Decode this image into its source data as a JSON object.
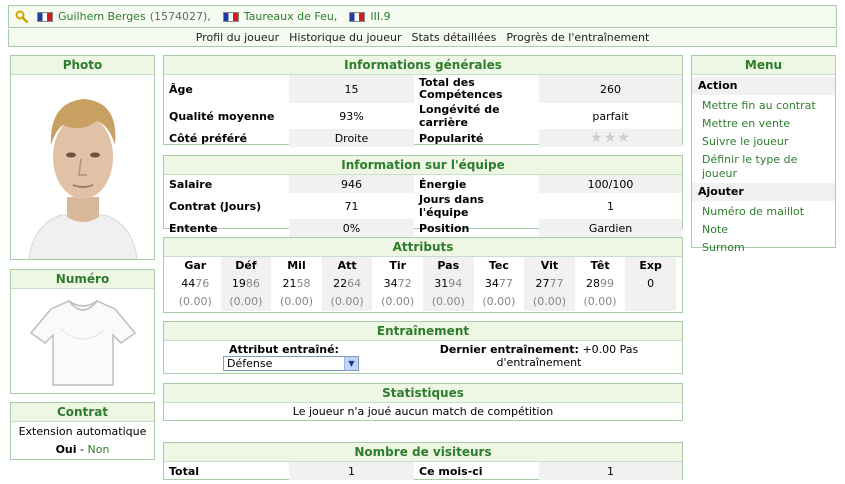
{
  "header": {
    "player_name": "Guilhem Berges",
    "player_id": "(1574027),",
    "team_name": "Taureaux de Feu,",
    "league": "III.9"
  },
  "tabs": [
    "Profil du joueur",
    "Historique du joueur",
    "Stats détaillées",
    "Progrès de l'entraînement"
  ],
  "photo": {
    "title": "Photo"
  },
  "numero": {
    "title": "Numéro"
  },
  "contrat": {
    "title": "Contrat",
    "extension": "Extension automatique",
    "yes": "Oui",
    "dash": " - ",
    "no": "Non"
  },
  "general": {
    "title": "Informations générales",
    "age_label": "Âge",
    "age": "15",
    "total_label": "Total des Compétences",
    "total": "260",
    "quality_label": "Qualité moyenne",
    "quality": "93%",
    "longevity_label": "Longévité de carrière",
    "longevity": "parfait",
    "side_label": "Côté préféré",
    "side": "Droite",
    "popularity_label": "Popularité",
    "popularity_stars": 0
  },
  "team": {
    "title": "Information sur l'équipe",
    "salary_label": "Salaire",
    "salary": "946",
    "energy_label": "Énergie",
    "energy": "100/100",
    "contract_label": "Contrat (Jours)",
    "contract": "71",
    "days_label": "Jours dans l'équipe",
    "days": "1",
    "entente_label": "Entente",
    "entente": "0%",
    "position_label": "Position",
    "position": "Gardien"
  },
  "attributes": {
    "title": "Attributs",
    "items": [
      {
        "name": "Gar",
        "whole": "44",
        "dec": "76",
        "chg": "(0.00)"
      },
      {
        "name": "Déf",
        "whole": "19",
        "dec": "86",
        "chg": "(0.00)"
      },
      {
        "name": "Mil",
        "whole": "21",
        "dec": "58",
        "chg": "(0.00)"
      },
      {
        "name": "Att",
        "whole": "22",
        "dec": "64",
        "chg": "(0.00)"
      },
      {
        "name": "Tir",
        "whole": "34",
        "dec": "72",
        "chg": "(0.00)"
      },
      {
        "name": "Pas",
        "whole": "31",
        "dec": "94",
        "chg": "(0.00)"
      },
      {
        "name": "Tec",
        "whole": "34",
        "dec": "77",
        "chg": "(0.00)"
      },
      {
        "name": "Vit",
        "whole": "27",
        "dec": "77",
        "chg": "(0.00)"
      },
      {
        "name": "Têt",
        "whole": "28",
        "dec": "99",
        "chg": "(0.00)"
      },
      {
        "name": "Exp",
        "whole": "0",
        "dec": "",
        "chg": ""
      }
    ]
  },
  "training": {
    "title": "Entraînement",
    "attr_label": "Attribut entraîné:",
    "attr_value": "Défense",
    "last_label": "Dernier entraînement:",
    "last_value": "+0.00 Pas d'entraînement"
  },
  "stats": {
    "title": "Statistiques",
    "text": "Le joueur n'a joué aucun match de compétition"
  },
  "visitors": {
    "title": "Nombre de visiteurs",
    "total_label": "Total",
    "total": "1",
    "month_label": "Ce mois-ci",
    "month": "1"
  },
  "menu": {
    "title": "Menu",
    "action_label": "Action",
    "action_items": [
      "Mettre fin au contrat",
      "Mettre en vente",
      "Suivre le joueur",
      "Définir le type de joueur"
    ],
    "add_label": "Ajouter",
    "add_items": [
      "Numéro de maillot",
      "Note",
      "Surnom"
    ]
  },
  "colors": {
    "accent": "#2d7d2d",
    "border": "#a9cda9",
    "header_bg": "#eef6e4"
  }
}
